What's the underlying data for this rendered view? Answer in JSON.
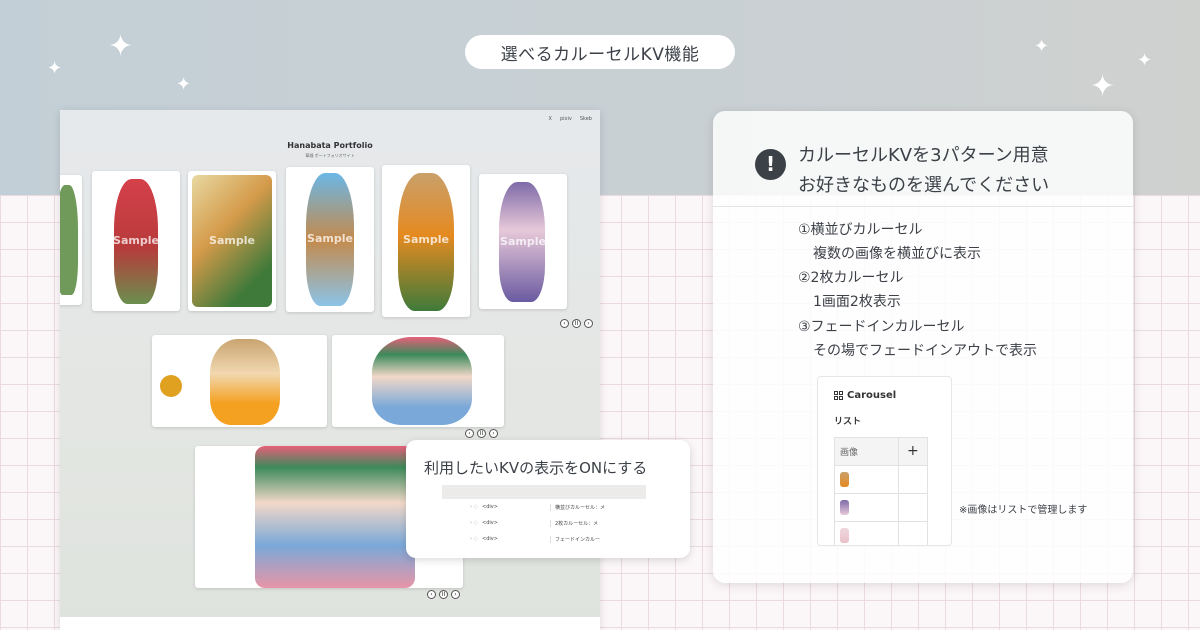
{
  "header": {
    "title": "選べるカルーセルKV機能"
  },
  "site": {
    "nav": [
      "X",
      "pixiv",
      "Skeb"
    ],
    "title": "Hanabata Portfolio",
    "subtitle": "華畑 ポートフォリオサイト"
  },
  "carousel": {
    "watermark": "Sample",
    "controls": [
      "‹",
      "II",
      "›"
    ]
  },
  "callout": {
    "title": "利用したいKVの表示をONにする",
    "rows": [
      {
        "tag": "<div>",
        "label": "横並びカルーセル：メ"
      },
      {
        "tag": "<div>",
        "label": "2枚カルーセル：メ"
      },
      {
        "tag": "<div>",
        "label": "フェードインカルー"
      }
    ]
  },
  "panel": {
    "heading_line1": "カルーセルKVを3パターン用意",
    "heading_line2": "お好きなものを選んでください",
    "features": [
      {
        "title": "①横並びカルーセル",
        "desc": "複数の画像を横並びに表示"
      },
      {
        "title": "②2枚カルーセル",
        "desc": "1画面2枚表示"
      },
      {
        "title": "③フェードインカルーセル",
        "desc": "その場でフェードインアウトで表示"
      }
    ],
    "carousel_title": "Carousel",
    "list_label": "リスト",
    "col_image": "画像",
    "add_symbol": "+",
    "note": "※画像はリストで管理します"
  },
  "colors": {
    "text": "#3c4148",
    "accent": "#ffffff"
  }
}
